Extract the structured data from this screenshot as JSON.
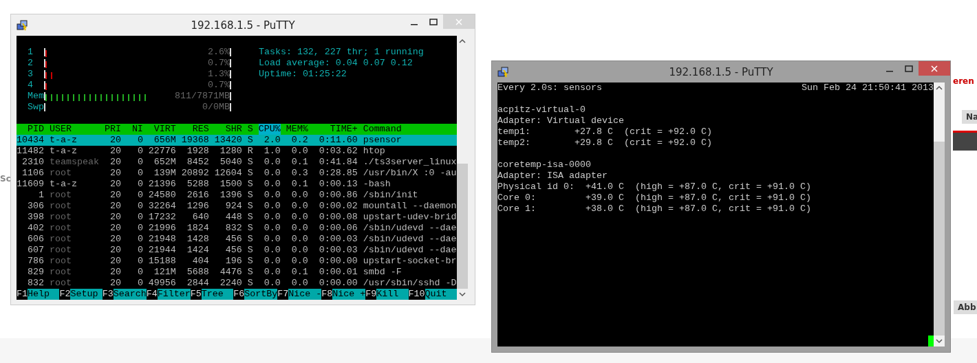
{
  "page": {
    "side_fragment": "Sc",
    "header_fragment": "eren",
    "button_fragment": "Na",
    "cancel_fragment": "Abb"
  },
  "htop_window": {
    "title": "192.168.1.5 - PuTTY",
    "meters": [
      {
        "label": "1",
        "kind": "cpu",
        "level": 0.03,
        "value": "2.6%"
      },
      {
        "label": "2",
        "kind": "cpu",
        "level": 0.01,
        "value": "0.7%"
      },
      {
        "label": "3",
        "kind": "cpu",
        "level": 0.06,
        "value": "1.3%"
      },
      {
        "label": "4",
        "kind": "cpu",
        "level": 0.01,
        "value": "0.7%"
      },
      {
        "label": "Mem",
        "kind": "memory",
        "level": 0.56,
        "value": "811/7871MB"
      },
      {
        "label": "Swp",
        "kind": "swap",
        "level": 0,
        "value": "0/0MB"
      }
    ],
    "summary": [
      "Tasks: 132, 227 thr; 1 running",
      "Load average: 0.04 0.07 0.12",
      "Uptime: 01:25:22"
    ],
    "columns": [
      {
        "label": "PID",
        "sorted": false
      },
      {
        "label": "USER",
        "sorted": false
      },
      {
        "label": "PRI",
        "sorted": false
      },
      {
        "label": "NI",
        "sorted": false
      },
      {
        "label": "VIRT",
        "sorted": false
      },
      {
        "label": "RES",
        "sorted": false
      },
      {
        "label": "SHR",
        "sorted": false
      },
      {
        "label": "S",
        "sorted": false
      },
      {
        "label": "CPU%",
        "sorted": true
      },
      {
        "label": "MEM%",
        "sorted": false
      },
      {
        "label": "TIME+",
        "sorted": false
      },
      {
        "label": "Command",
        "sorted": false
      }
    ],
    "rows": [
      {
        "selected": true,
        "dim_user": false,
        "cells": [
          "10434",
          "t-a-z",
          "20",
          "0",
          "656M",
          "19368",
          "13420",
          "S",
          "2.0",
          "0.2",
          "0:11.60",
          "psensor"
        ]
      },
      {
        "selected": false,
        "dim_user": false,
        "cells": [
          "11482",
          "t-a-z",
          "20",
          "0",
          "22776",
          "1928",
          "1280",
          "R",
          "1.0",
          "0.0",
          "0:03.62",
          "htop"
        ]
      },
      {
        "selected": false,
        "dim_user": true,
        "cells": [
          "2310",
          "teamspeak",
          "20",
          "0",
          "652M",
          "8452",
          "5040",
          "S",
          "0.0",
          "0.1",
          "0:41.84",
          "./ts3server_linux"
        ]
      },
      {
        "selected": false,
        "dim_user": true,
        "cells": [
          "1106",
          "root",
          "20",
          "0",
          "139M",
          "20892",
          "12604",
          "S",
          "0.0",
          "0.3",
          "0:28.85",
          "/usr/bin/X :0 -au"
        ]
      },
      {
        "selected": false,
        "dim_user": false,
        "cells": [
          "11609",
          "t-a-z",
          "20",
          "0",
          "21396",
          "5288",
          "1500",
          "S",
          "0.0",
          "0.1",
          "0:00.13",
          "-bash"
        ]
      },
      {
        "selected": false,
        "dim_user": true,
        "cells": [
          "1",
          "root",
          "20",
          "0",
          "24580",
          "2616",
          "1396",
          "S",
          "0.0",
          "0.0",
          "0:00.86",
          "/sbin/init"
        ]
      },
      {
        "selected": false,
        "dim_user": true,
        "cells": [
          "306",
          "root",
          "20",
          "0",
          "32264",
          "1296",
          "924",
          "S",
          "0.0",
          "0.0",
          "0:00.02",
          "mountall --daemon"
        ]
      },
      {
        "selected": false,
        "dim_user": true,
        "cells": [
          "398",
          "root",
          "20",
          "0",
          "17232",
          "640",
          "448",
          "S",
          "0.0",
          "0.0",
          "0:00.08",
          "upstart-udev-brid"
        ]
      },
      {
        "selected": false,
        "dim_user": true,
        "cells": [
          "402",
          "root",
          "20",
          "0",
          "21996",
          "1824",
          "832",
          "S",
          "0.0",
          "0.0",
          "0:00.06",
          "/sbin/udevd --dae"
        ]
      },
      {
        "selected": false,
        "dim_user": true,
        "cells": [
          "606",
          "root",
          "20",
          "0",
          "21948",
          "1428",
          "456",
          "S",
          "0.0",
          "0.0",
          "0:00.03",
          "/sbin/udevd --dae"
        ]
      },
      {
        "selected": false,
        "dim_user": true,
        "cells": [
          "607",
          "root",
          "20",
          "0",
          "21944",
          "1424",
          "456",
          "S",
          "0.0",
          "0.0",
          "0:00.03",
          "/sbin/udevd --dae"
        ]
      },
      {
        "selected": false,
        "dim_user": true,
        "cells": [
          "786",
          "root",
          "20",
          "0",
          "15188",
          "404",
          "196",
          "S",
          "0.0",
          "0.0",
          "0:00.00",
          "upstart-socket-br"
        ]
      },
      {
        "selected": false,
        "dim_user": true,
        "cells": [
          "829",
          "root",
          "20",
          "0",
          "121M",
          "5688",
          "4476",
          "S",
          "0.0",
          "0.1",
          "0:00.01",
          "smbd -F"
        ]
      },
      {
        "selected": false,
        "dim_user": true,
        "cells": [
          "832",
          "root",
          "20",
          "0",
          "49956",
          "2844",
          "2240",
          "S",
          "0.0",
          "0.0",
          "0:00.00",
          "/usr/sbin/sshd -D"
        ]
      }
    ],
    "function_keys": [
      {
        "key": "F1",
        "label": "Help"
      },
      {
        "key": "F2",
        "label": "Setup"
      },
      {
        "key": "F3",
        "label": "Search"
      },
      {
        "key": "F4",
        "label": "Filter"
      },
      {
        "key": "F5",
        "label": "Tree"
      },
      {
        "key": "F6",
        "label": "SortBy"
      },
      {
        "key": "F7",
        "label": "Nice -"
      },
      {
        "key": "F8",
        "label": "Nice +"
      },
      {
        "key": "F9",
        "label": "Kill"
      },
      {
        "key": "F10",
        "label": "Quit"
      }
    ]
  },
  "sensors_window": {
    "title": "192.168.1.5 - PuTTY",
    "command": "Every 2.0s: sensors",
    "timestamp": "Sun Feb 24 21:50:41 2013",
    "blocks": [
      {
        "lines": [
          "acpitz-virtual-0",
          "Adapter: Virtual device",
          "temp1:        +27.8 C  (crit = +92.0 C)",
          "temp2:        +29.8 C  (crit = +92.0 C)"
        ]
      },
      {
        "lines": [
          "coretemp-isa-0000",
          "Adapter: ISA adapter",
          "Physical id 0:  +41.0 C  (high = +87.0 C, crit = +91.0 C)",
          "Core 0:         +39.0 C  (high = +87.0 C, crit = +91.0 C)",
          "Core 1:         +38.0 C  (high = +87.0 C, crit = +91.0 C)"
        ]
      }
    ]
  }
}
